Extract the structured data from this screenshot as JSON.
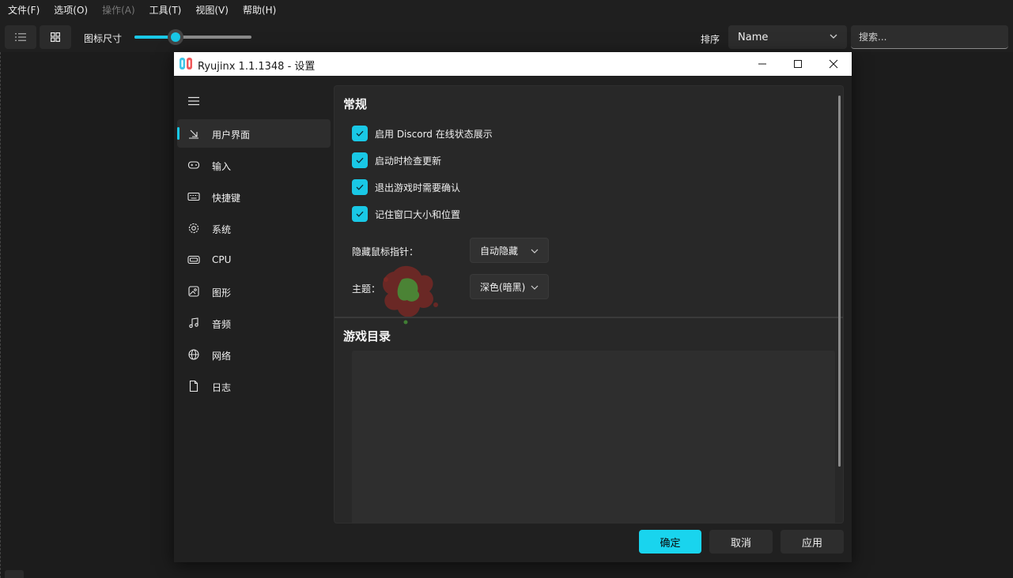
{
  "menubar": {
    "items": [
      "文件(F)",
      "选项(O)",
      "操作(A)",
      "工具(T)",
      "视图(V)",
      "帮助(H)"
    ]
  },
  "toolbar": {
    "icon_size_label": "图标尺寸",
    "icon_size_fraction": 0.35,
    "sort_label": "排序",
    "sort_value": "Name",
    "search_placeholder": "搜索..."
  },
  "settings": {
    "window_title": "Ryujinx 1.1.1348 - 设置",
    "nav": [
      {
        "label": "用户界面",
        "icon": "user-interface-icon",
        "active": true
      },
      {
        "label": "输入",
        "icon": "gamepad-icon"
      },
      {
        "label": "快捷键",
        "icon": "keyboard-icon"
      },
      {
        "label": "系统",
        "icon": "gear-icon"
      },
      {
        "label": "CPU",
        "icon": "cpu-icon"
      },
      {
        "label": "图形",
        "icon": "image-icon"
      },
      {
        "label": "音频",
        "icon": "music-note-icon"
      },
      {
        "label": "网络",
        "icon": "globe-icon"
      },
      {
        "label": "日志",
        "icon": "document-icon"
      }
    ],
    "general_title": "常规",
    "checkboxes": [
      {
        "label": "启用 Discord 在线状态展示",
        "checked": true
      },
      {
        "label": "启动时检查更新",
        "checked": true
      },
      {
        "label": "退出游戏时需要确认",
        "checked": true
      },
      {
        "label": "记住窗口大小和位置",
        "checked": true
      }
    ],
    "hide_cursor_label": "隐藏鼠标指针：",
    "hide_cursor_value": "自动隐藏",
    "theme_label": "主题：",
    "theme_value": "深色(暗黑)",
    "game_dirs_title": "游戏目录",
    "buttons": {
      "ok": "确定",
      "cancel": "取消",
      "apply": "应用"
    }
  },
  "colors": {
    "accent": "#19c8e6",
    "window_bg": "#202020",
    "content_bg": "#282828"
  }
}
